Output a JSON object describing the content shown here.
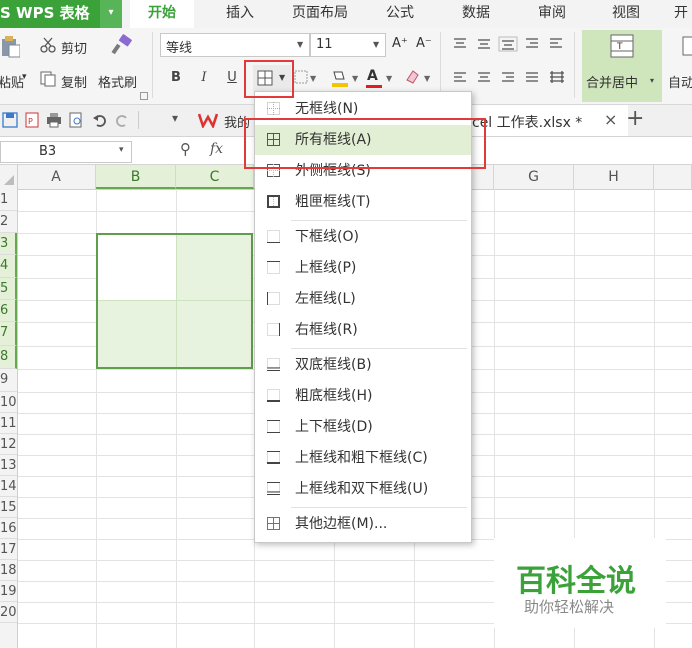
{
  "app": {
    "title": "S WPS 表格",
    "menu_arrow": "▾"
  },
  "tabs": [
    {
      "label": "开始",
      "active": true
    },
    {
      "label": "插入"
    },
    {
      "label": "页面布局"
    },
    {
      "label": "公式"
    },
    {
      "label": "数据"
    },
    {
      "label": "审阅"
    },
    {
      "label": "视图"
    },
    {
      "label": "开"
    }
  ],
  "ribbon": {
    "paste_label": "粘贴",
    "paste_arrow": "▾",
    "cut_label": "剪切",
    "copy_label": "复制",
    "format_painter_label": "格式刷",
    "font_name": "等线",
    "font_size": "11",
    "font_grow": "A⁺",
    "font_shrink": "A⁻",
    "bold": "B",
    "italic": "I",
    "underline": "U",
    "font_color_letter": "A",
    "merge_center_label": "合并居中",
    "merge_center_arrow": "▾",
    "auto_wrap_label": "自动",
    "colors": {
      "accent": "#3ba23a",
      "font_color_bar": "#e02020",
      "fill_color_bar": "#f5c400",
      "callout": "#e03a3a"
    }
  },
  "doc_tabs": {
    "first_label": "我的",
    "current_file": "cel 工作表.xlsx *",
    "close": "×",
    "add": "+"
  },
  "formula_bar": {
    "cell_ref": "B3",
    "arrow": "▾",
    "zoom_icon": "⚲",
    "fx": "fx"
  },
  "columns": [
    "A",
    "B",
    "C",
    "G",
    "H"
  ],
  "rows": [
    "1",
    "2",
    "3",
    "4",
    "5",
    "6",
    "7",
    "8",
    "9",
    "10",
    "11",
    "12",
    "13",
    "14",
    "15",
    "16",
    "17",
    "18",
    "19",
    "20"
  ],
  "border_menu": {
    "items": [
      {
        "label": "无框线(N)"
      },
      {
        "label": "所有框线(A)",
        "highlighted": true
      },
      {
        "label": "外侧框线(S)"
      },
      {
        "label": "粗匣框线(T)"
      },
      {
        "label": "下框线(O)"
      },
      {
        "label": "上框线(P)"
      },
      {
        "label": "左框线(L)"
      },
      {
        "label": "右框线(R)"
      },
      {
        "label": "双底框线(B)"
      },
      {
        "label": "粗底框线(H)"
      },
      {
        "label": "上下框线(D)"
      },
      {
        "label": "上框线和粗下框线(C)"
      },
      {
        "label": "上框线和双下框线(U)"
      },
      {
        "label": "其他边框(M)..."
      }
    ]
  },
  "watermark": {
    "title": "百科全说",
    "subtitle": "助你轻松解决"
  }
}
